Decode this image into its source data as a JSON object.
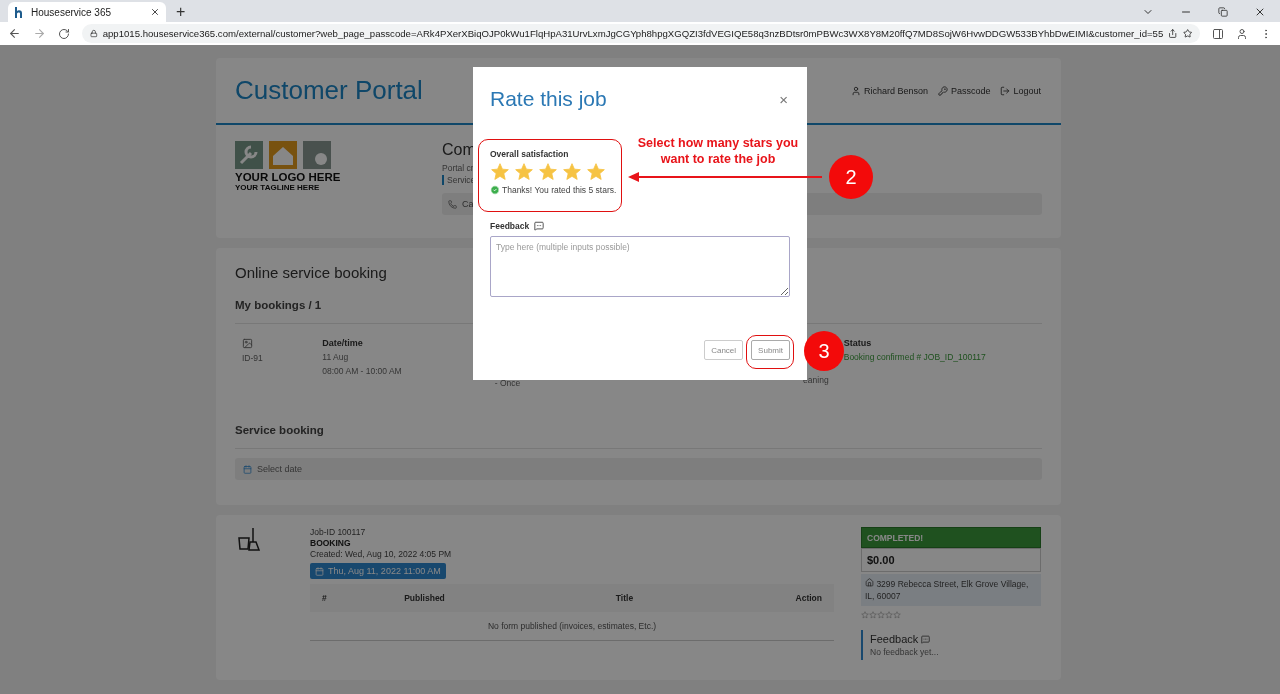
{
  "browser": {
    "tab_title": "Houseservice 365",
    "new_tab": "+",
    "url": "app1015.houseservice365.com/external/customer?web_page_passcode=ARk4PXerXBiqOJP0kWu1FlqHpA31UrvLxmJgCGYph8hpgXGQZI3fdVEGIQE58q3nzBDtsr0mPBWc3WX8Y8M20ffQ7MD8SojW6HvwDDGW533BYhbDwEIMI&customer_id=55"
  },
  "header": {
    "title": "Customer Portal",
    "links": [
      {
        "kind": "user",
        "label": "Richard Benson"
      },
      {
        "kind": "key",
        "label": "Passcode"
      },
      {
        "kind": "logout",
        "label": "Logout"
      }
    ]
  },
  "logo": {
    "line_1": "YOUR LOGO HERE",
    "line_2": "YOUR TAGLINE HERE"
  },
  "company": {
    "name": "Com",
    "description": "Portal cr",
    "service": "Service",
    "phone": "Ca"
  },
  "booking_section": {
    "title": "Online service booking",
    "subtitle": "My bookings / 1",
    "booking": {
      "id": "ID-91",
      "date_label": "Date/time",
      "date": "11 Aug",
      "time": "08:00 AM - 10:00 AM",
      "frequency": "- Once",
      "service": "eaning",
      "status_label": "Status",
      "status": "Booking confirmed # JOB_ID_100117"
    }
  },
  "service_booking": {
    "title": "Service booking",
    "date_placeholder": "Select date"
  },
  "job": {
    "id": "Job-ID 100117",
    "type": "BOOKING",
    "created": "Created: Wed, Aug 10, 2022 4:05 PM",
    "date": "Thu, Aug 11, 2022 11:00 AM",
    "columns": [
      "#",
      "Published",
      "Title",
      "Action"
    ],
    "empty": "No form published (invoices, estimates, Etc.)",
    "status": "COMPLETED!",
    "price": "$0.00",
    "address": "3299 Rebecca Street, Elk Grove Village, IL, 60007",
    "stars": 0,
    "feedback_title": "Feedback",
    "feedback": "No feedback yet..."
  },
  "modal": {
    "title": "Rate this job",
    "close": "×",
    "rating_label": "Overall satisfaction",
    "stars": 5,
    "rating_message": "Thanks! You rated this 5 stars.",
    "feedback_label": "Feedback",
    "feedback_placeholder": "Type here (multiple inputs possible)",
    "buttons": [
      {
        "kind": "cancel",
        "label": "Cancel"
      },
      {
        "kind": "submit",
        "label": "Submit"
      }
    ]
  },
  "annotations": [
    {
      "number": "2",
      "text": "Select how many stars you want to rate the job"
    },
    {
      "number": "3"
    }
  ]
}
